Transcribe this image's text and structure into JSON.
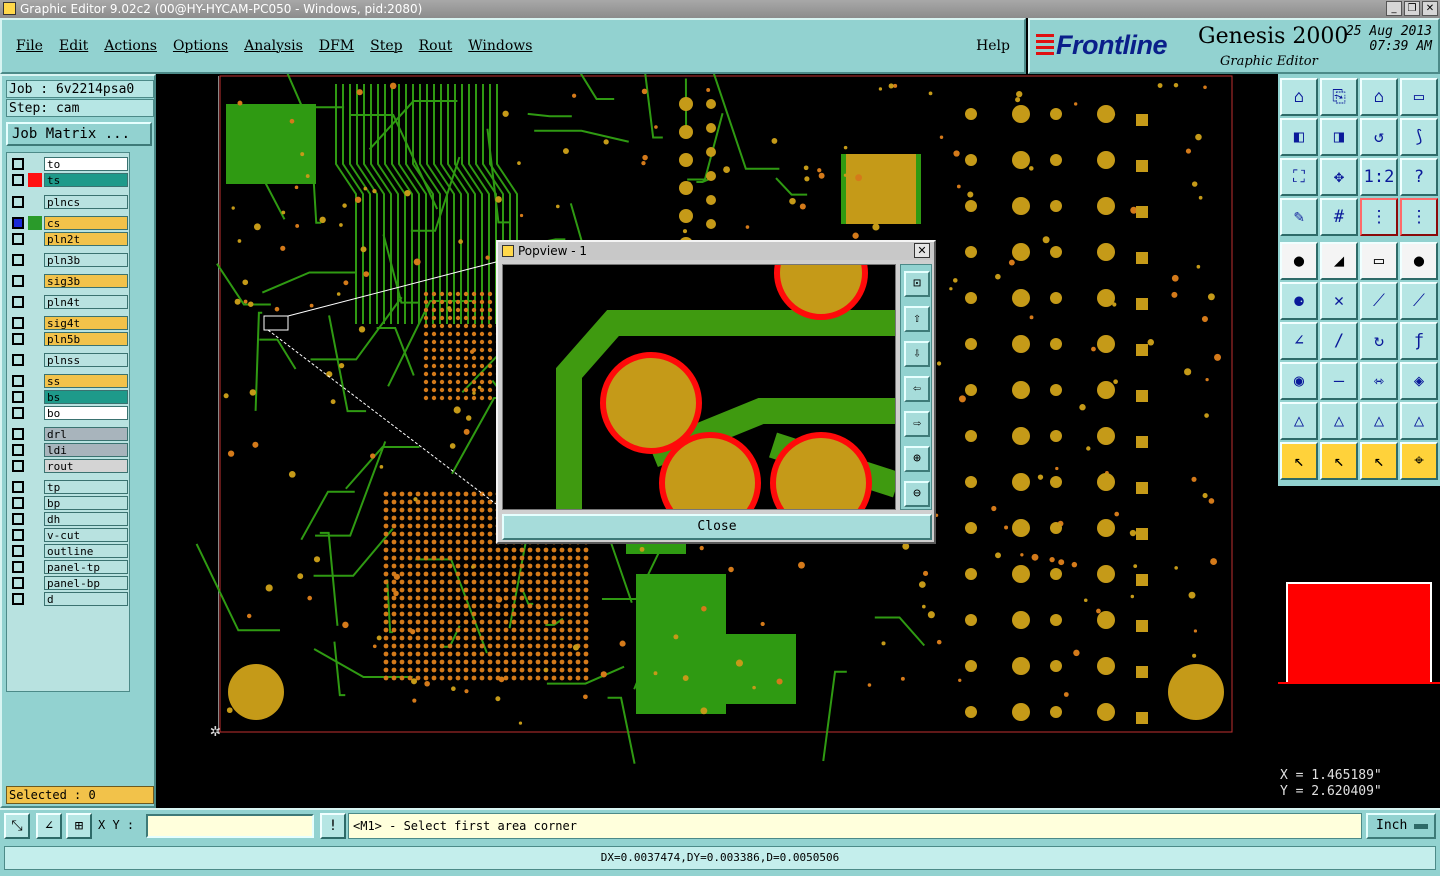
{
  "window": {
    "title": "Graphic Editor 9.02c2 (00@HY-HYCAM-PC050 - Windows, pid:2080)"
  },
  "menu": {
    "items": [
      "File",
      "Edit",
      "Actions",
      "Options",
      "Analysis",
      "DFM",
      "Step",
      "Rout",
      "Windows"
    ],
    "help": "Help"
  },
  "brand": {
    "logo": "Frontline",
    "product": "Genesis 2000",
    "subtitle": "Graphic Editor",
    "date": "25 Aug 2013",
    "time": "07:39 AM"
  },
  "job": {
    "job_line": "Job : 6v2214psa0",
    "step_line": "Step: cam",
    "matrix_label": "Job Matrix ..."
  },
  "layers": [
    {
      "name": "to",
      "color": "#ffffff",
      "swatch": "",
      "checked": false
    },
    {
      "name": "ts",
      "color": "#1e9a8a",
      "swatch": "#ff1010",
      "checked": false
    },
    {
      "name": "plncs",
      "color": "#b8e2e0",
      "swatch": "",
      "checked": false
    },
    {
      "name": "cs",
      "color": "#f2c24a",
      "swatch": "#2a9a2a",
      "checked": true
    },
    {
      "name": "pln2t",
      "color": "#f2c24a",
      "swatch": "",
      "checked": false
    },
    {
      "name": "pln3b",
      "color": "#b8e2e0",
      "swatch": "",
      "checked": false
    },
    {
      "name": "sig3b",
      "color": "#f2c24a",
      "swatch": "",
      "checked": false
    },
    {
      "name": "pln4t",
      "color": "#b8e2e0",
      "swatch": "",
      "checked": false
    },
    {
      "name": "sig4t",
      "color": "#f2c24a",
      "swatch": "",
      "checked": false
    },
    {
      "name": "pln5b",
      "color": "#f2c24a",
      "swatch": "",
      "checked": false
    },
    {
      "name": "plnss",
      "color": "#b8e2e0",
      "swatch": "",
      "checked": false
    },
    {
      "name": "ss",
      "color": "#f2c24a",
      "swatch": "",
      "checked": false
    },
    {
      "name": "bs",
      "color": "#1e9a8a",
      "swatch": "",
      "checked": false
    },
    {
      "name": "bo",
      "color": "#ffffff",
      "swatch": "",
      "checked": false
    },
    {
      "name": "drl",
      "color": "#a8b4bc",
      "swatch": "",
      "checked": false
    },
    {
      "name": "ldi",
      "color": "#a8b4bc",
      "swatch": "",
      "checked": false
    },
    {
      "name": "rout",
      "color": "#d4d4d4",
      "swatch": "",
      "checked": false
    },
    {
      "name": "tp",
      "color": "#b8e2e0",
      "swatch": "",
      "checked": false
    },
    {
      "name": "bp",
      "color": "#b8e2e0",
      "swatch": "",
      "checked": false
    },
    {
      "name": "dh",
      "color": "#b8e2e0",
      "swatch": "",
      "checked": false
    },
    {
      "name": "v-cut",
      "color": "#b8e2e0",
      "swatch": "",
      "checked": false
    },
    {
      "name": "outline",
      "color": "#b8e2e0",
      "swatch": "",
      "checked": false
    },
    {
      "name": "panel-tp",
      "color": "#b8e2e0",
      "swatch": "",
      "checked": false
    },
    {
      "name": "panel-bp",
      "color": "#b8e2e0",
      "swatch": "",
      "checked": false
    },
    {
      "name": "d",
      "color": "#b8e2e0",
      "swatch": "",
      "checked": false
    }
  ],
  "selected": "Selected : 0",
  "popview": {
    "title": "Popview - 1",
    "close_label": "Close",
    "tools": [
      "zoom-fit-icon",
      "pan-up-icon",
      "pan-down-icon",
      "pan-left-icon",
      "pan-right-icon",
      "zoom-in-icon",
      "zoom-out-icon"
    ]
  },
  "toolbar": {
    "buttons": [
      "home-view-icon",
      "redraw-icon",
      "house-icon",
      "window-icon",
      "pan-left-icon",
      "pan-right-icon",
      "flip-icon",
      "snake-icon",
      "zoom-fit-icon",
      "zoom-center-icon",
      "one-to-two-icon",
      "help-icon",
      "measure-icon",
      "grid-icon",
      "layer-red-icon",
      "layer-red2-icon",
      "pad-icon",
      "line-icon",
      "ruler-icon",
      "dot-icon",
      "node-icon",
      "cross-icon",
      "line-points-icon",
      "arrow-points-icon",
      "angle-icon",
      "slash-icon",
      "arc-icon",
      "text-f-icon",
      "point-icon",
      "bar-icon",
      "dimension-icon",
      "shape-icon",
      "triangle-icon",
      "triangle-a-icon",
      "triangle-b-icon",
      "triangle-c-icon",
      "select-icon",
      "select-box-icon",
      "select-arrow-icon",
      "select-path-icon"
    ]
  },
  "coords": {
    "x": "X = 1.465189\"",
    "y": "Y = 2.620409\""
  },
  "command": {
    "xy_label": "X Y :",
    "xy_value": "",
    "prompt": "<M1> - Select first area corner",
    "units": "Inch"
  },
  "status": {
    "delta": "DX=0.0037474,DY=0.003386,D=0.0050506"
  }
}
